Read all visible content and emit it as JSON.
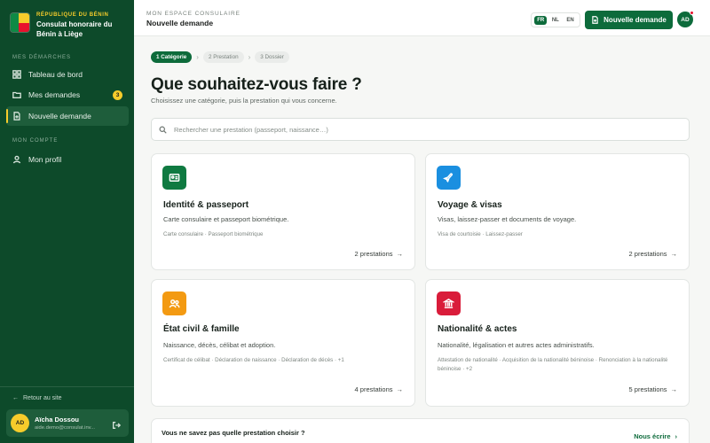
{
  "colors": {
    "sidebar_bg": "#0d4a2a",
    "accent": "#0d6b3b",
    "flag_green": "#0f8a45",
    "flag_yellow": "#f6cc2b",
    "flag_red": "#e8112d",
    "identity_icon": "#0f7a41",
    "travel_icon": "#1a8fe0",
    "civil_icon": "#f39a12",
    "nationality_icon": "#d91c3a"
  },
  "brand": {
    "subtitle": "RÉPUBLIQUE DU BÉNIN",
    "title": "Consulat honoraire du Bénin à Liège",
    "icon": "benin-flag"
  },
  "sidebar": {
    "section_requests": "MES DÉMARCHES",
    "items": [
      {
        "label": "Tableau de bord",
        "icon": "dashboard-icon"
      },
      {
        "label": "Mes demandes",
        "icon": "folder-icon",
        "badge": "3"
      },
      {
        "label": "Nouvelle demande",
        "icon": "file-plus-icon",
        "active": true
      }
    ],
    "section_account": "MON COMPTE",
    "account_items": [
      {
        "label": "Mon profil",
        "icon": "user-icon"
      }
    ],
    "back_link": "Retour au site"
  },
  "user": {
    "initials": "AD",
    "name": "Aïcha Dossou",
    "email": "aide.demo@consulat.inv..."
  },
  "topbar": {
    "breadcrumb_section": "MON ESPACE CONSULAIRE",
    "breadcrumb_title": "Nouvelle demande",
    "languages": [
      "FR",
      "NL",
      "EN"
    ],
    "active_language": "FR",
    "new_request_label": "Nouvelle demande",
    "avatar_initials": "AD"
  },
  "steps": [
    {
      "label": "1  Catégorie",
      "active": true
    },
    {
      "label": "2  Prestation",
      "active": false
    },
    {
      "label": "3  Dossier",
      "active": false
    }
  ],
  "main": {
    "heading": "Que souhaitez-vous faire ?",
    "lead": "Choisissez une catégorie, puis la prestation qui vous concerne.",
    "search_placeholder": "Rechercher une prestation (passeport, naissance…)",
    "search_value": ""
  },
  "categories": [
    {
      "title": "Identité & passeport",
      "description": "Carte consulaire et passeport biométrique.",
      "tags": "Carte consulaire · Passeport biométrique",
      "count": "2 prestations",
      "icon": "id-card-icon"
    },
    {
      "title": "Voyage & visas",
      "description": "Visas, laissez-passer et documents de voyage.",
      "tags": "Visa de courtoisie · Laissez-passer",
      "count": "2 prestations",
      "icon": "plane-icon"
    },
    {
      "title": "État civil & famille",
      "description": "Naissance, décès, célibat et adoption.",
      "tags": "Certificat de célibat · Déclaration de naissance · Déclaration de décès · +1",
      "count": "4 prestations",
      "icon": "family-icon"
    },
    {
      "title": "Nationalité & actes",
      "description": "Nationalité, légalisation et autres actes administratifs.",
      "tags": "Attestation de nationalité · Acquisition de la nationalité béninoise · Renonciation à la nationalité béninoise · +2",
      "count": "5 prestations",
      "icon": "institution-icon"
    }
  ],
  "help": {
    "question": "Vous ne savez pas quelle prestation choisir ?",
    "link_label": "Nous écrire"
  }
}
